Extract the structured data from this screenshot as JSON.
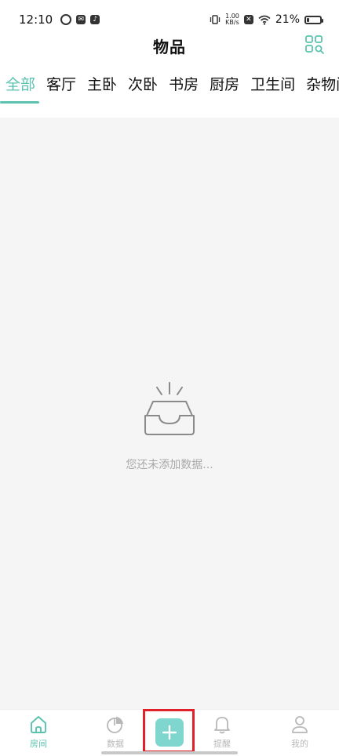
{
  "status_bar": {
    "time": "12:10",
    "net_speed_value": "1.00",
    "net_speed_unit": "KB/s",
    "battery_percent": "21%",
    "battery_level": 0.21
  },
  "header": {
    "title": "物品"
  },
  "tabs": [
    {
      "label": "全部",
      "active": true
    },
    {
      "label": "客厅",
      "active": false
    },
    {
      "label": "主卧",
      "active": false
    },
    {
      "label": "次卧",
      "active": false
    },
    {
      "label": "书房",
      "active": false
    },
    {
      "label": "厨房",
      "active": false
    },
    {
      "label": "卫生间",
      "active": false
    },
    {
      "label": "杂物间",
      "active": false
    }
  ],
  "empty_state": {
    "icon": "empty-inbox-icon",
    "text": "您还未添加数据..."
  },
  "bottom_nav": {
    "items": [
      {
        "label": "房间",
        "icon": "home-icon",
        "active": true
      },
      {
        "label": "数据",
        "icon": "pie-chart-icon",
        "active": false
      },
      {
        "label": "提醒",
        "icon": "bell-icon",
        "active": false
      },
      {
        "label": "我的",
        "icon": "user-icon",
        "active": false
      }
    ],
    "add_icon": "plus-icon"
  },
  "colors": {
    "accent": "#5bc2b0",
    "add_button": "#7fd6cf",
    "highlight": "#e0202a",
    "content_bg": "#f5f5f5",
    "inactive": "#b8b8b8"
  }
}
